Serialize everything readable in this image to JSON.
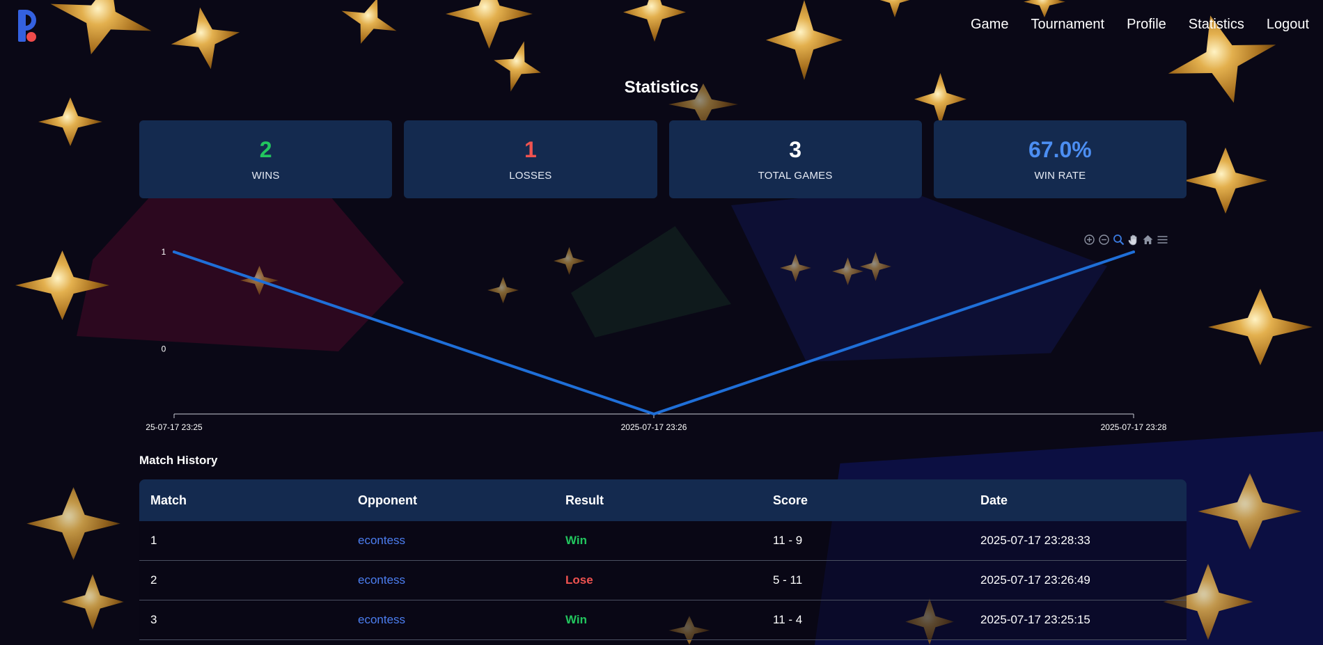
{
  "nav": {
    "logo": "p-logo-icon",
    "items": [
      "Game",
      "Tournament",
      "Profile",
      "Statistics",
      "Logout"
    ]
  },
  "page_title": "Statistics",
  "stats": [
    {
      "value": "2",
      "label": "WINS",
      "color": "#22c55e"
    },
    {
      "value": "1",
      "label": "LOSSES",
      "color": "#ef5350"
    },
    {
      "value": "3",
      "label": "TOTAL GAMES",
      "color": "#ffffff"
    },
    {
      "value": "67.0%",
      "label": "WIN RATE",
      "color": "#4c8ef2"
    }
  ],
  "chart_toolbar": [
    "zoom-in-icon",
    "zoom-out-icon",
    "selection-zoom-icon",
    "pan-icon",
    "reset-home-icon",
    "menu-icon"
  ],
  "chart_data": {
    "type": "line",
    "x": [
      "25-07-17 23:25",
      "2025-07-17 23:26",
      "2025-07-17 23:28"
    ],
    "series": [
      {
        "values": [
          1,
          -0.67,
          1
        ],
        "color": "#1f6fd8"
      }
    ],
    "y_ticks": [
      "1",
      "0"
    ],
    "ylim": [
      -0.67,
      1
    ],
    "grid": false
  },
  "match_history": {
    "title": "Match History",
    "columns": [
      "Match",
      "Opponent",
      "Result",
      "Score",
      "Date"
    ],
    "rows": [
      {
        "match": "1",
        "opponent": "econtess",
        "result": "Win",
        "score": "11 - 9",
        "date": "2025-07-17 23:28:33"
      },
      {
        "match": "2",
        "opponent": "econtess",
        "result": "Lose",
        "score": "5 - 11",
        "date": "2025-07-17 23:26:49"
      },
      {
        "match": "3",
        "opponent": "econtess",
        "result": "Win",
        "score": "11 - 4",
        "date": "2025-07-17 23:25:15"
      }
    ]
  },
  "colors": {
    "background": "#0a0816",
    "card": "#142a4f",
    "win": "#22c55e",
    "lose": "#ef5350",
    "link": "#4c7ef0"
  }
}
